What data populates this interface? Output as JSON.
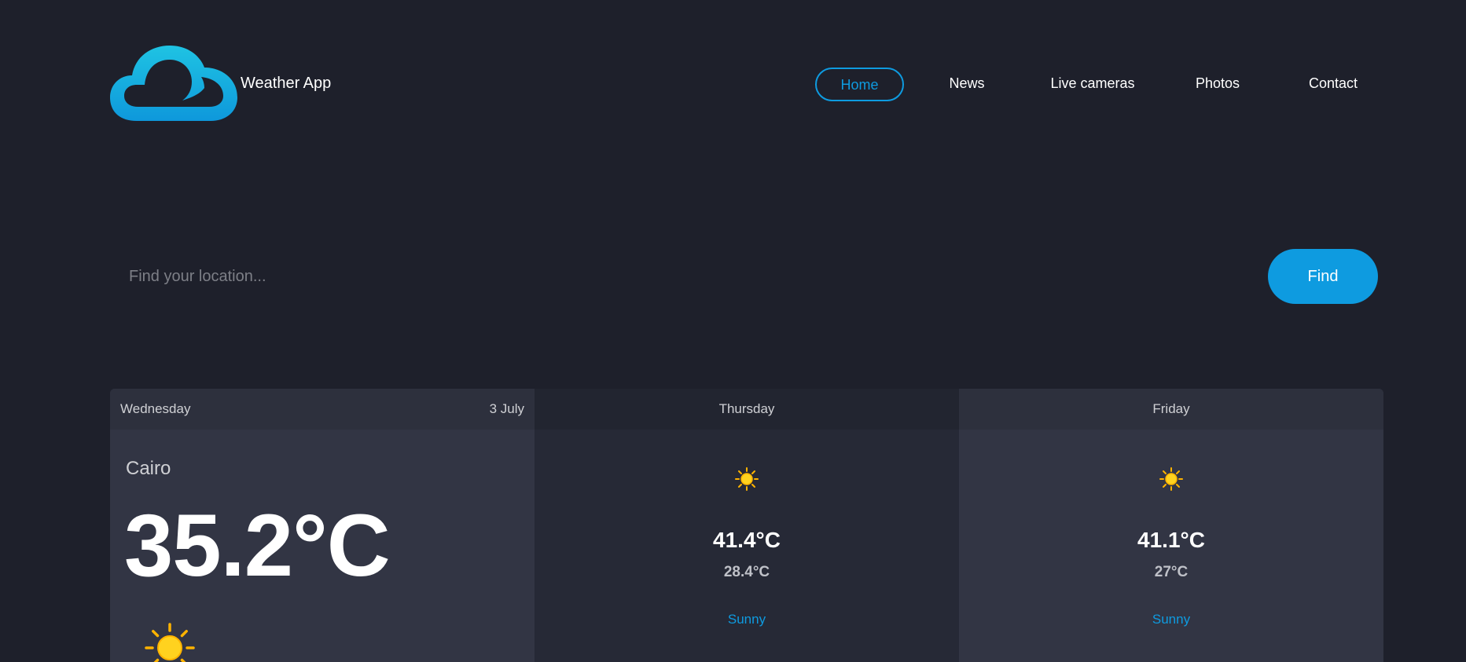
{
  "header": {
    "brand": "Weather App",
    "nav": [
      "Home",
      "News",
      "Live cameras",
      "Photos",
      "Contact"
    ],
    "active_nav": "Home"
  },
  "search": {
    "placeholder": "Find your location...",
    "button_label": "Find"
  },
  "forecast": {
    "today": {
      "day": "Wednesday",
      "date": "3 July",
      "location": "Cairo",
      "temperature": "35.2°C",
      "icon": "sun-icon"
    },
    "days": [
      {
        "day": "Thursday",
        "max": "41.4°C",
        "min": "28.4°C",
        "condition": "Sunny",
        "icon": "sun-icon"
      },
      {
        "day": "Friday",
        "max": "41.1°C",
        "min": "27°C",
        "condition": "Sunny",
        "icon": "sun-icon"
      }
    ]
  },
  "colors": {
    "background": "#1e202b",
    "accent": "#0e9be0",
    "card_light": "#323544",
    "card_dark": "#262936",
    "sun": "#ffd21f"
  }
}
